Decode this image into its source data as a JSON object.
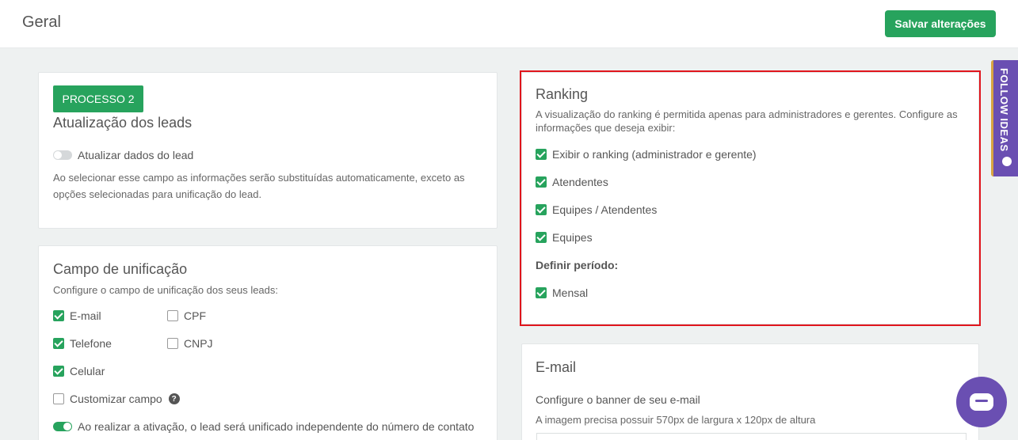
{
  "header": {
    "title": "Geral",
    "save_label": "Salvar alterações"
  },
  "leads_card": {
    "badge": "PROCESSO 2",
    "title": "Atualização dos leads",
    "toggle_label": "Atualizar dados do lead",
    "toggle_on": false,
    "description_line1": "Ao selecionar esse campo as informações serão substituídas automaticamente, exceto as",
    "description_line2": "opções selecionadas para unificação do lead."
  },
  "unification_card": {
    "title": "Campo de unificação",
    "subtitle": "Configure o campo de unificação dos seus leads:",
    "options": [
      {
        "label": "E-mail",
        "checked": true
      },
      {
        "label": "CPF",
        "checked": false
      },
      {
        "label": "Telefone",
        "checked": true
      },
      {
        "label": "CNPJ",
        "checked": false
      },
      {
        "label": "Celular",
        "checked": true
      },
      {
        "label": "Customizar campo",
        "checked": false
      }
    ],
    "activation_label": "Ao realizar a ativação, o lead será unificado independente do número de contato",
    "activation_on": true
  },
  "ranking_card": {
    "title": "Ranking",
    "description_line1": "A visualização do ranking é permitida apenas para administradores e gerentes. Configure as",
    "description_line2": "informações que deseja exibir:",
    "options": [
      {
        "label": "Exibir o ranking (administrador e gerente)",
        "checked": true
      },
      {
        "label": "Atendentes",
        "checked": true
      },
      {
        "label": "Equipes / Atendentes",
        "checked": true
      },
      {
        "label": "Equipes",
        "checked": true
      }
    ],
    "period_heading": "Definir período:",
    "period_options": [
      {
        "label": "Mensal",
        "checked": true
      }
    ]
  },
  "email_card": {
    "title": "E-mail",
    "banner_label": "Configure o banner de seu e-mail",
    "banner_hint": "A imagem precisa possuir 570px de largura x 120px de altura"
  },
  "widgets": {
    "follow_ideas": "FOLLOW IDEAS"
  },
  "colors": {
    "accent": "#27a35d",
    "highlight": "#e0151c",
    "widget": "#6a4fb2"
  }
}
